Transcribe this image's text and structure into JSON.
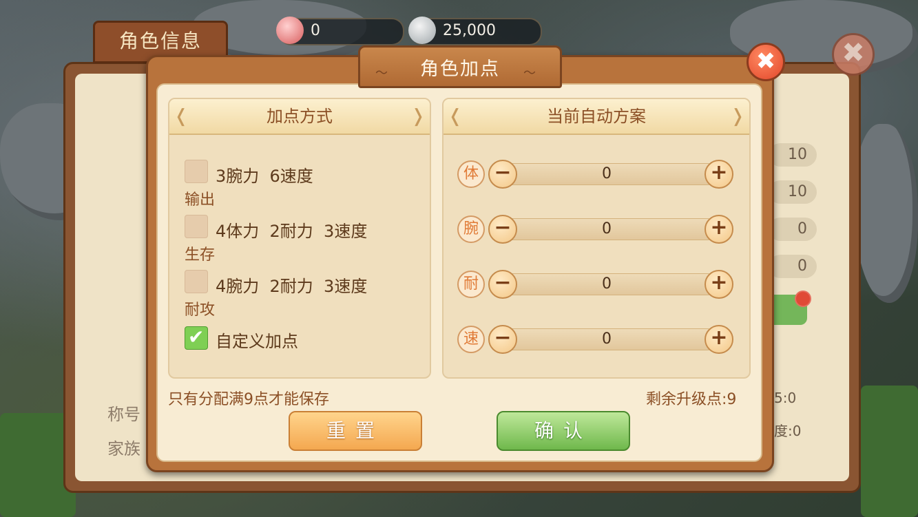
{
  "currency": {
    "gems": "0",
    "silver": "25,000"
  },
  "background_panel": {
    "tab_title": "角色信息",
    "close_icon": "close-icon",
    "stat_values": [
      "10",
      "10",
      "0",
      "0"
    ],
    "labels": {
      "title_label": "称号",
      "family_label": "家族"
    },
    "partial_values": [
      "5:0",
      "度:0"
    ]
  },
  "dialog": {
    "title": "角色加点",
    "close_label": "✖",
    "method_panel": {
      "header": "加点方式",
      "options": [
        {
          "label": "3腕力  6速度",
          "sub": "输出",
          "checked": false
        },
        {
          "label": "4体力  2耐力  3速度",
          "sub": "生存",
          "checked": false
        },
        {
          "label": "4腕力  2耐力  3速度",
          "sub": "耐攻",
          "checked": false
        },
        {
          "label": "自定义加点",
          "sub": "",
          "checked": true
        }
      ]
    },
    "auto_panel": {
      "header": "当前自动方案",
      "stats": [
        {
          "badge": "体",
          "value": "0"
        },
        {
          "badge": "腕",
          "value": "0"
        },
        {
          "badge": "耐",
          "value": "0"
        },
        {
          "badge": "速",
          "value": "0"
        }
      ],
      "minus": "−",
      "plus": "+"
    },
    "notice": "只有分配满9点才能保存",
    "remaining_label": "剩余升级点:",
    "remaining_value": "9",
    "reset_label": "重置",
    "confirm_label": "确认"
  },
  "colors": {
    "accent_orange": "#e07a36",
    "confirm_green": "#6fb84c",
    "frame_brown": "#b8733c"
  }
}
